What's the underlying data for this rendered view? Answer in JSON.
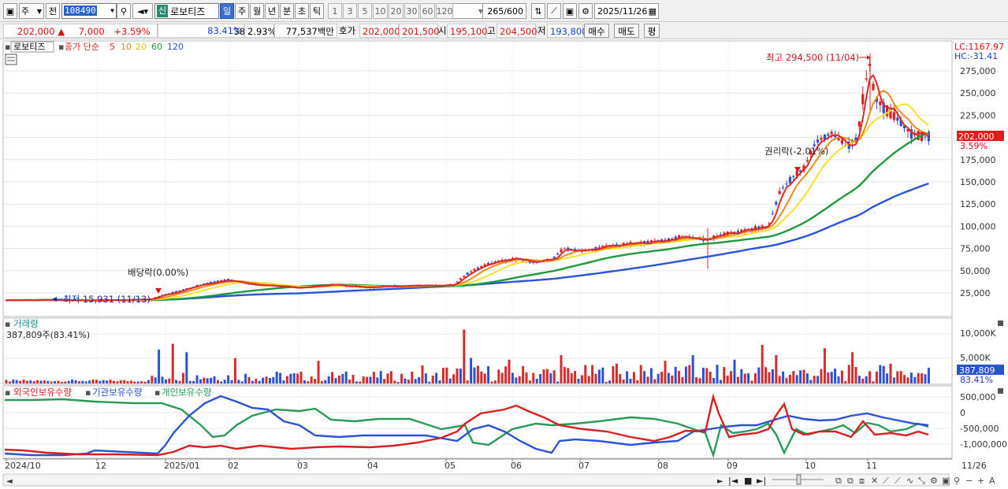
{
  "toolbar": {
    "market": "주",
    "prev": "전",
    "code": "108490",
    "name": "로보티즈",
    "shin_badge": "신",
    "periods": [
      "일",
      "주",
      "월",
      "년",
      "분",
      "초",
      "틱"
    ],
    "active_period": "일",
    "numbers": [
      "1",
      "3",
      "5",
      "10",
      "20",
      "30",
      "60",
      "120"
    ],
    "count": "265",
    "count_total": "/600",
    "date": "2025/11/26"
  },
  "quote": {
    "price": "202,000",
    "change_arrow": "▲",
    "change": "7,000",
    "change_pct": "+3.59%",
    "volume": "387,809",
    "volume_ratio": "83.41%",
    "turnover": "2.93%",
    "amount": "77,537백만",
    "ask_label": "호가",
    "ask1": "202,000",
    "ask2": "201,500",
    "open_label": "시",
    "open": "195,100",
    "high_label": "고",
    "high": "204,500",
    "low_label": "저",
    "low": "193,800",
    "buy": "매수",
    "sell": "매도",
    "eval": "평"
  },
  "price_panel": {
    "stock": "로보티즈",
    "ma_label": "종가 단순",
    "ma_periods": [
      "5",
      "10",
      "20",
      "60",
      "120"
    ],
    "ma_colors": [
      "#d92a2a",
      "#ef8a1d",
      "#f2e128",
      "#1d9a3c",
      "#2a52d8"
    ],
    "lc": "LC:1167.97",
    "hc": "HC:-31.41",
    "price_tag": "202,000",
    "pct_tag": "3.59%",
    "high_note": "최고 294,500 (11/04)",
    "low_note": "최저 15,931 (11/13)",
    "div_note": "배당락(0.00%)",
    "rights_note": "권리락(-2.01%)",
    "y_ticks": [
      "275,000",
      "250,000",
      "225,000",
      "200,000",
      "175,000",
      "150,000",
      "125,000",
      "100,000",
      "75,000",
      "50,000",
      "25,000"
    ]
  },
  "volume_panel": {
    "title": "거래량",
    "info": "387,809주(83.41%)",
    "y_ticks": [
      "10,000K",
      "5,000K"
    ],
    "tag": "387,809",
    "tag_pct": "83.41%"
  },
  "holding_panel": {
    "legend": [
      "외국인보유수량",
      "기관보유수량",
      "개인보유수량"
    ],
    "colors": [
      "#d81f1f",
      "#2a52d8",
      "#2a9a5a"
    ],
    "y_ticks": [
      "500,000",
      "0",
      "-500,000",
      "-1,000,000"
    ]
  },
  "x_axis": {
    "labels": [
      "2024/10",
      "12",
      "2025/01",
      "02",
      "03",
      "04",
      "05",
      "06",
      "07",
      "08",
      "09",
      "10",
      "11"
    ],
    "end_label": "11/26"
  },
  "chart_data": {
    "type": "candlestick",
    "price_series": [
      {
        "name": "5",
        "color": "#d92a2a"
      },
      {
        "name": "10",
        "color": "#ef8a1d"
      },
      {
        "name": "20",
        "color": "#f2e128"
      },
      {
        "name": "60",
        "color": "#1d9a3c"
      },
      {
        "name": "120",
        "color": "#2a52d8"
      }
    ],
    "close_by_month": [
      {
        "x": "2024/10",
        "close": 17000
      },
      {
        "x": "2024/12",
        "close": 18000
      },
      {
        "x": "2025/01",
        "close": 35000
      },
      {
        "x": "2025/02",
        "close": 33000
      },
      {
        "x": "2025/03",
        "close": 31000
      },
      {
        "x": "2025/04",
        "close": 32000
      },
      {
        "x": "2025/05",
        "close": 57000
      },
      {
        "x": "2025/06",
        "close": 68000
      },
      {
        "x": "2025/07",
        "close": 78000
      },
      {
        "x": "2025/08",
        "close": 85000
      },
      {
        "x": "2025/09",
        "close": 150000
      },
      {
        "x": "2025/10",
        "close": 195000
      },
      {
        "x": "2025/11",
        "close": 202000
      }
    ],
    "high": {
      "x": "11/04",
      "value": 294500
    },
    "low": {
      "x": "11/13",
      "value": 15931
    },
    "ylim": [
      0,
      300000
    ],
    "holding_series": [
      {
        "name": "외국인보유수량"
      },
      {
        "name": "기관보유수량"
      },
      {
        "name": "개인보유수량"
      }
    ]
  }
}
